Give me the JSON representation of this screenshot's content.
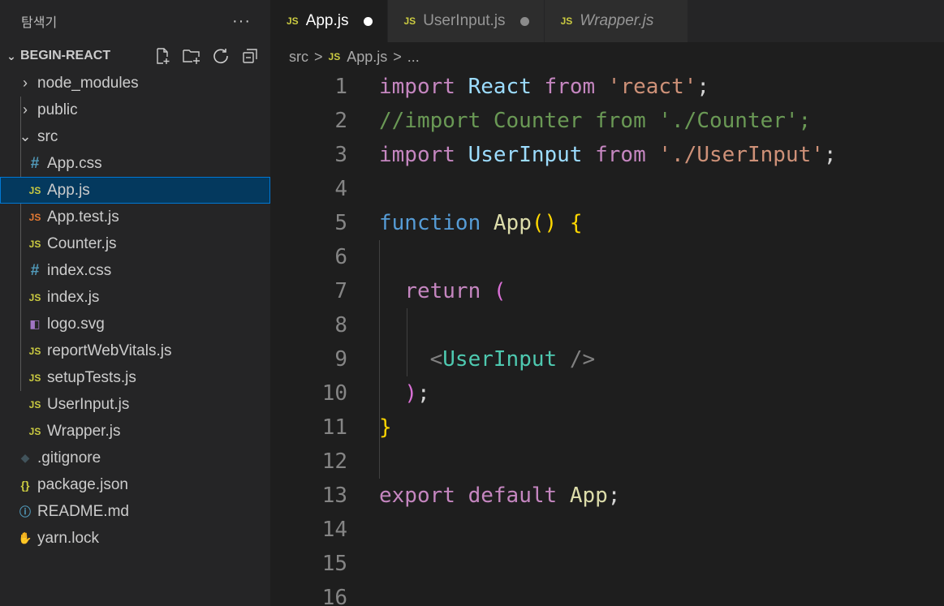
{
  "sidebar": {
    "header_title": "탐색기",
    "more": "···",
    "section_title": "BEGIN-REACT",
    "items": [
      {
        "label": "node_modules",
        "type": "folder",
        "chev": "›",
        "icon": "chevron-right-icon"
      },
      {
        "label": "public",
        "type": "folder",
        "chev": "›",
        "icon": "chevron-right-icon"
      },
      {
        "label": "src",
        "type": "folder-open",
        "chev": "⌄",
        "icon": "chevron-down-icon"
      },
      {
        "label": "App.css",
        "type": "css",
        "glyph": "#",
        "icon": "css-file-icon"
      },
      {
        "label": "App.js",
        "type": "js",
        "glyph": "JS",
        "icon": "js-file-icon",
        "selected": true
      },
      {
        "label": "App.test.js",
        "type": "jstest",
        "glyph": "JS",
        "icon": "test-file-icon"
      },
      {
        "label": "Counter.js",
        "type": "js",
        "glyph": "JS",
        "icon": "js-file-icon"
      },
      {
        "label": "index.css",
        "type": "css",
        "glyph": "#",
        "icon": "css-file-icon"
      },
      {
        "label": "index.js",
        "type": "js",
        "glyph": "JS",
        "icon": "js-file-icon"
      },
      {
        "label": "logo.svg",
        "type": "svg",
        "glyph": "◧",
        "icon": "svg-file-icon"
      },
      {
        "label": "reportWebVitals.js",
        "type": "js",
        "glyph": "JS",
        "icon": "js-file-icon"
      },
      {
        "label": "setupTests.js",
        "type": "js",
        "glyph": "JS",
        "icon": "js-file-icon"
      },
      {
        "label": "UserInput.js",
        "type": "js",
        "glyph": "JS",
        "icon": "js-file-icon"
      },
      {
        "label": "Wrapper.js",
        "type": "js",
        "glyph": "JS",
        "icon": "js-file-icon"
      },
      {
        "label": ".gitignore",
        "type": "git",
        "glyph": "◆",
        "icon": "git-file-icon"
      },
      {
        "label": "package.json",
        "type": "json",
        "glyph": "{}",
        "icon": "json-file-icon"
      },
      {
        "label": "README.md",
        "type": "info",
        "glyph": "ⓘ",
        "icon": "info-file-icon"
      },
      {
        "label": "yarn.lock",
        "type": "yarn",
        "glyph": "✋",
        "icon": "yarn-file-icon"
      }
    ]
  },
  "tabs": [
    {
      "label": "App.js",
      "badge": "JS",
      "active": true,
      "dirty": true
    },
    {
      "label": "UserInput.js",
      "badge": "JS",
      "active": false,
      "dirty": true
    },
    {
      "label": "Wrapper.js",
      "badge": "JS",
      "active": false,
      "dirty": false,
      "italic": true
    }
  ],
  "breadcrumb": {
    "folder": "src",
    "sep": ">",
    "badge": "JS",
    "file": "App.js",
    "ellipsis": "..."
  },
  "code": {
    "line_numbers": [
      "1",
      "2",
      "3",
      "4",
      "5",
      "6",
      "7",
      "8",
      "9",
      "10",
      "11",
      "12",
      "13",
      "14",
      "15",
      "16"
    ],
    "lines": [
      [
        {
          "t": "import",
          "c": "kw"
        },
        {
          "t": " "
        },
        {
          "t": "React",
          "c": "var"
        },
        {
          "t": " "
        },
        {
          "t": "from",
          "c": "kw"
        },
        {
          "t": " "
        },
        {
          "t": "'react'",
          "c": "str"
        },
        {
          "t": ";"
        }
      ],
      [
        {
          "t": "//import Counter from './Counter';",
          "c": "cm"
        }
      ],
      [
        {
          "t": "import",
          "c": "kw"
        },
        {
          "t": " "
        },
        {
          "t": "UserInput",
          "c": "var"
        },
        {
          "t": " "
        },
        {
          "t": "from",
          "c": "kw"
        },
        {
          "t": " "
        },
        {
          "t": "'./UserInput'",
          "c": "str"
        },
        {
          "t": ";"
        }
      ],
      [],
      [
        {
          "t": "function",
          "c": "kw2"
        },
        {
          "t": " "
        },
        {
          "t": "App",
          "c": "fn"
        },
        {
          "t": "()",
          "c": "brace"
        },
        {
          "t": " "
        },
        {
          "t": "{",
          "c": "brace"
        }
      ],
      [],
      [
        {
          "t": "  "
        },
        {
          "t": "return",
          "c": "kw"
        },
        {
          "t": " "
        },
        {
          "t": "(",
          "c": "brace2"
        }
      ],
      [],
      [
        {
          "t": "    "
        },
        {
          "t": "<",
          "c": "punc"
        },
        {
          "t": "UserInput",
          "c": "tag"
        },
        {
          "t": " "
        },
        {
          "t": "/>",
          "c": "punc"
        }
      ],
      [
        {
          "t": "  "
        },
        {
          "t": ")",
          "c": "brace2"
        },
        {
          "t": ";"
        }
      ],
      [
        {
          "t": "}",
          "c": "brace"
        }
      ],
      [],
      [
        {
          "t": "export",
          "c": "kw"
        },
        {
          "t": " "
        },
        {
          "t": "default",
          "c": "kw"
        },
        {
          "t": " "
        },
        {
          "t": "App",
          "c": "fn"
        },
        {
          "t": ";"
        }
      ],
      [],
      [],
      []
    ]
  }
}
